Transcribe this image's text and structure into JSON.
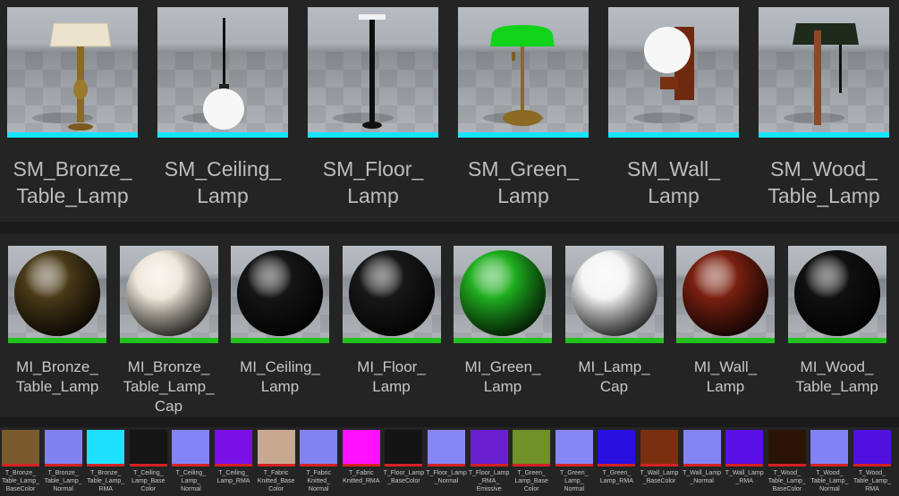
{
  "static_meshes": [
    {
      "label": "SM_Bronze_\nTable_Lamp",
      "icon": "bronze-table-lamp-icon"
    },
    {
      "label": "SM_Ceiling_\nLamp",
      "icon": "ceiling-lamp-icon"
    },
    {
      "label": "SM_Floor_\nLamp",
      "icon": "floor-lamp-icon"
    },
    {
      "label": "SM_Green_\nLamp",
      "icon": "green-lamp-icon"
    },
    {
      "label": "SM_Wall_\nLamp",
      "icon": "wall-lamp-icon"
    },
    {
      "label": "SM_Wood_\nTable_Lamp",
      "icon": "wood-table-lamp-icon"
    }
  ],
  "material_instances": [
    {
      "label": "MI_Bronze_\nTable_Lamp",
      "color": "#4a3a18"
    },
    {
      "label": "MI_Bronze_\nTable_Lamp_\nCap",
      "color": "#eee7da"
    },
    {
      "label": "MI_Ceiling_\nLamp",
      "color": "#151515"
    },
    {
      "label": "MI_Floor_\nLamp",
      "color": "#181818"
    },
    {
      "label": "MI_Green_\nLamp",
      "color": "#1fae1f"
    },
    {
      "label": "MI_Lamp_\nCap",
      "color": "#f4f4f4"
    },
    {
      "label": "MI_Wall_\nLamp",
      "color": "#7a2010"
    },
    {
      "label": "MI_Wood_\nTable_Lamp",
      "color": "#101010"
    }
  ],
  "textures": [
    {
      "label": "T_Bronze_\nTable_Lamp_\nBaseColor",
      "color": "#7a5a2e"
    },
    {
      "label": "T_Bronze_\nTable_Lamp_\nNormal",
      "color": "#8080f0"
    },
    {
      "label": "T_Bronze_\nTable_Lamp_\nRMA",
      "color": "#20e0ff"
    },
    {
      "label": "T_Ceiling_\nLamp_Base\nColor",
      "color": "#151515"
    },
    {
      "label": "T_Ceiling_\nLamp_\nNormal",
      "color": "#8484f6"
    },
    {
      "label": "T_Ceiling_\nLamp_RMA",
      "color": "#7a10e6"
    },
    {
      "label": "T_Fabric\nKnitted_Base\nColor",
      "color": "#c8a890"
    },
    {
      "label": "T_Fabric\nKnitted_\nNormal",
      "color": "#8282f2"
    },
    {
      "label": "T_Fabric\nKnitted_RMA",
      "color": "#ff10ff"
    },
    {
      "label": "T_Floor_Lamp\n_BaseColor",
      "color": "#141414"
    },
    {
      "label": "T_Floor_Lamp\n_Normal",
      "color": "#8585f4"
    },
    {
      "label": "T_Floor_Lamp\n_RMA_\nEmissive",
      "color": "#6a20d0"
    },
    {
      "label": "T_Green_\nLamp_Base\nColor",
      "color": "#70902a"
    },
    {
      "label": "T_Green_\nLamp_\nNormal",
      "color": "#8686f6"
    },
    {
      "label": "T_Green_\nLamp_RMA",
      "color": "#2a10e0"
    },
    {
      "label": "T_Wall_Lamp\n_BaseColor",
      "color": "#7a3010"
    },
    {
      "label": "T_Wall_Lamp\n_Normal",
      "color": "#8484f4"
    },
    {
      "label": "T_Wall_Lamp\n_RMA",
      "color": "#5a10e6"
    },
    {
      "label": "T_Wood_\nTable_Lamp_\nBaseColor",
      "color": "#2a1408"
    },
    {
      "label": "T_Wood_\nTable_Lamp_\nNormal",
      "color": "#8282f4"
    },
    {
      "label": "T_Wood_\nTable_Lamp_\nRMA",
      "color": "#5010e0"
    }
  ]
}
